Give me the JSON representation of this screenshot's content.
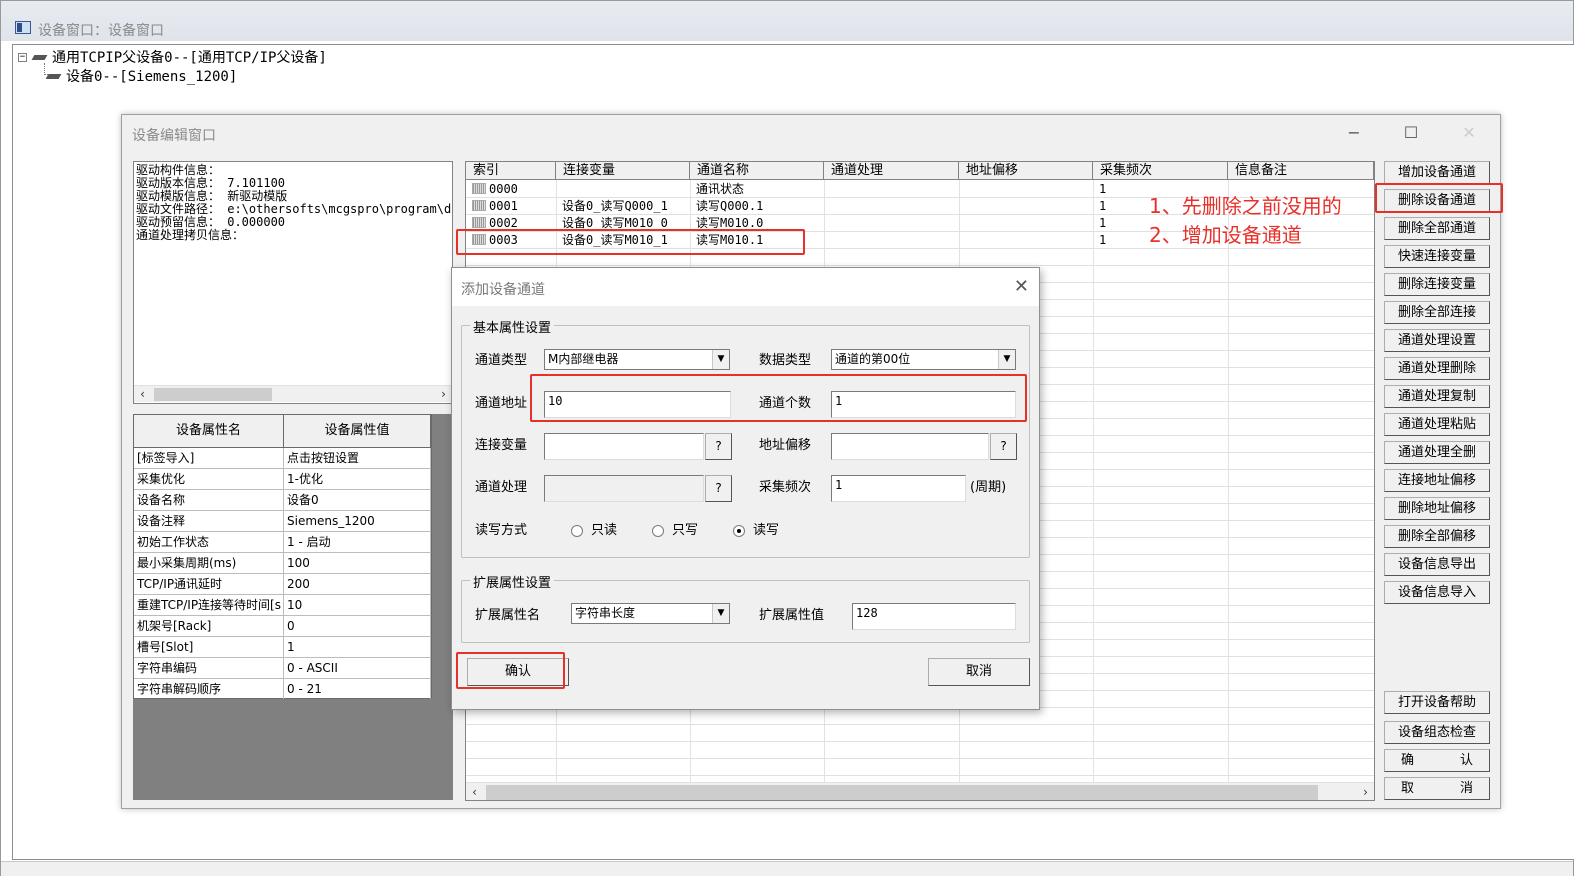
{
  "outer_window": {
    "title": "设备窗口：设备窗口"
  },
  "tree": {
    "parent_expander": "−",
    "parent": "通用TCPIP父设备0--[通用TCP/IP父设备]",
    "child": "设备0--[Siemens_1200]"
  },
  "edit_window": {
    "title": "设备编辑窗口",
    "window_buttons": {
      "minimize": "−",
      "maximize": "☐",
      "close": "✕"
    },
    "driver_info": [
      "驱动构件信息：",
      "驱动版本信息：  7.101100",
      "驱动模版信息：  新驱动模版",
      "驱动文件路径：  e:\\othersofts\\mcgspro\\program\\dri",
      "驱动预留信息：  0.000000",
      "通道处理拷贝信息："
    ],
    "scroll_left": "‹",
    "scroll_right": "›",
    "property_table": {
      "headers": [
        "设备属性名",
        "设备属性值"
      ],
      "rows": [
        [
          "[标签导入]",
          "点击按钮设置"
        ],
        [
          "采集优化",
          "1-优化"
        ],
        [
          "设备名称",
          "设备0"
        ],
        [
          "设备注释",
          "Siemens_1200"
        ],
        [
          "初始工作状态",
          "1 - 启动"
        ],
        [
          "最小采集周期(ms)",
          "100"
        ],
        [
          "TCP/IP通讯延时",
          "200"
        ],
        [
          "重建TCP/IP连接等待时间[s",
          "10"
        ],
        [
          "机架号[Rack]",
          "0"
        ],
        [
          "槽号[Slot]",
          "1"
        ],
        [
          "字符串编码",
          "0 - ASCII"
        ],
        [
          "字符串解码顺序",
          "0 - 21"
        ]
      ]
    },
    "channel_grid": {
      "headers": [
        "索引",
        "连接变量",
        "通道名称",
        "通道处理",
        "地址偏移",
        "采集频次",
        "信息备注"
      ],
      "rows": [
        {
          "index": "0000",
          "variable": "",
          "name": "通讯状态",
          "freq": "1"
        },
        {
          "index": "0001",
          "variable": "设备0_读写Q000_1",
          "name": "读写Q000.1",
          "freq": "1"
        },
        {
          "index": "0002",
          "variable": "设备0_读写M010_0",
          "name": "读写M010.0",
          "freq": "1"
        },
        {
          "index": "0003",
          "variable": "设备0_读写M010_1",
          "name": "读写M010.1",
          "freq": "1"
        }
      ]
    },
    "side_buttons": [
      "增加设备通道",
      "删除设备通道",
      "删除全部通道",
      "快速连接变量",
      "删除连接变量",
      "删除全部连接",
      "通道处理设置",
      "通道处理删除",
      "通道处理复制",
      "通道处理粘贴",
      "通道处理全删",
      "连接地址偏移",
      "删除地址偏移",
      "删除全部偏移",
      "设备信息导出",
      "设备信息导入"
    ],
    "bottom_buttons": {
      "help": "打开设备帮助",
      "check": "设备组态检查",
      "ok_a": "确",
      "ok_b": "认",
      "cancel_a": "取",
      "cancel_b": "消"
    }
  },
  "annotations": {
    "line1": "1、先删除之前没用的",
    "line2": "2、增加设备通道",
    "color": "#e8302a"
  },
  "dialog": {
    "title": "添加设备通道",
    "close": "✕",
    "basic_group": "基本属性设置",
    "channel_type_label": "通道类型",
    "channel_type_value": "M内部继电器",
    "data_type_label": "数据类型",
    "data_type_value": "通道的第00位",
    "channel_addr_label": "通道地址",
    "channel_addr_value": "10",
    "channel_count_label": "通道个数",
    "channel_count_value": "1",
    "link_var_label": "连接变量",
    "link_var_value": "",
    "addr_offset_label": "地址偏移",
    "addr_offset_value": "",
    "channel_proc_label": "通道处理",
    "channel_proc_value": "",
    "collect_freq_label": "采集频次",
    "collect_freq_value": "1",
    "period_label": "(周期)",
    "question": "?",
    "rw_label": "读写方式",
    "rw_options": [
      "只读",
      "只写",
      "读写"
    ],
    "rw_selected": "读写",
    "ext_group": "扩展属性设置",
    "ext_name_label": "扩展属性名",
    "ext_name_value": "字符串长度",
    "ext_value_label": "扩展属性值",
    "ext_value_value": "128",
    "ok": "确认",
    "cancel": "取消"
  }
}
